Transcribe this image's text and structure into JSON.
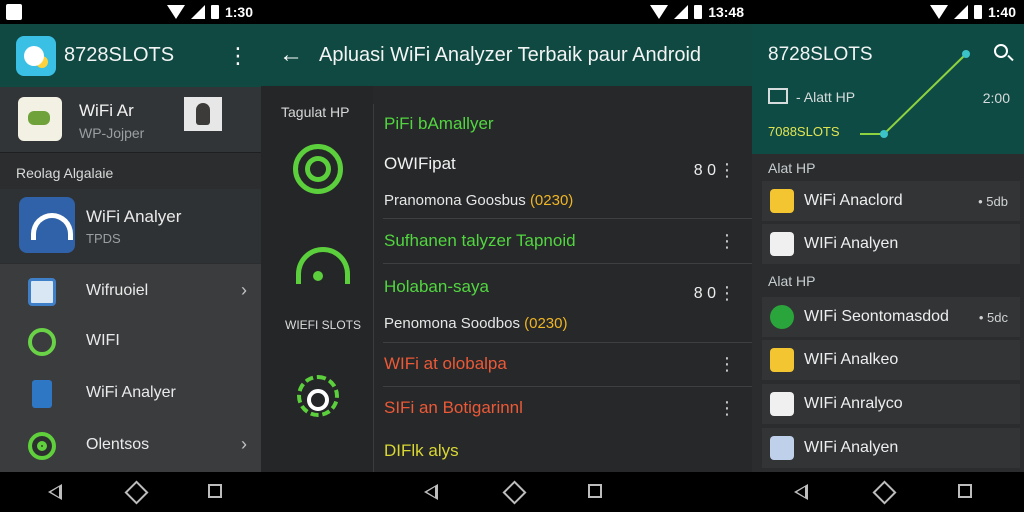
{
  "panel1": {
    "status_time": "1:30",
    "app_title": "8728SLOTS",
    "header": {
      "name": "WiFi Ar",
      "sub": "WP-Jojper"
    },
    "section": "Reolag Algalaie",
    "feature": {
      "name": "WiFi Analyer",
      "sub": "TPDS"
    },
    "menu": [
      {
        "label": "Wifruoiel",
        "icon": "device-icon",
        "chevron": true
      },
      {
        "label": "WIFI",
        "icon": "ring-icon",
        "chevron": false
      },
      {
        "label": "WiFi Analyer",
        "icon": "phone-icon",
        "chevron": false
      },
      {
        "label": "Olentsos",
        "icon": "target-icon",
        "chevron": true
      }
    ]
  },
  "panel2": {
    "status_time": "13:48",
    "title": "Apluasi WiFi Analyzer Terbaik paur Android",
    "left": {
      "header": "Tagulat HP",
      "caption": "WIEFI SLOTS"
    },
    "rows": [
      {
        "text": "PiFi bAmallyer",
        "color": "green"
      },
      {
        "text": "OWIFipat",
        "color": "white",
        "num": "8 0"
      },
      {
        "text": "Pranomona Goosbus",
        "highlight": "(0230)",
        "color": "sub"
      },
      {
        "text": "Sufhanen talyzer Tapnoid",
        "color": "green"
      },
      {
        "text": "Holaban-saya",
        "color": "green",
        "num": "8 0"
      },
      {
        "text": "Penomona Soodbos",
        "highlight": "(0230)",
        "color": "sub"
      },
      {
        "text": "WIFi at olobalpa",
        "color": "red"
      },
      {
        "text": "SIFi an Botigarinnl",
        "color": "red"
      },
      {
        "text": "DIFlk alys",
        "color": "yellow"
      }
    ]
  },
  "panel3": {
    "status_time": "1:40",
    "title": "8728SLOTS",
    "meta_label": "- Alatt HP",
    "meta_value": "2:00",
    "tag": "7088SLOTS",
    "section1": "Alat HP",
    "section2": "Alat HP",
    "items": [
      {
        "label": "WiFi Anaclord",
        "value": "• 5db",
        "icon": "yellow"
      },
      {
        "label": "WIFi Analyen",
        "value": "",
        "icon": "white"
      },
      {
        "label": "WIFi Seontomasdod",
        "value": "• 5dc",
        "icon": "green"
      },
      {
        "label": "WIFi Analkeo",
        "value": "",
        "icon": "yellow"
      },
      {
        "label": "WIFi Anralyco",
        "value": "",
        "icon": "white"
      },
      {
        "label": "WIFi Analyen",
        "value": "",
        "icon": "pink"
      }
    ]
  },
  "colors": {
    "appbar": "#104842",
    "accent_green": "#52d640",
    "accent_red": "#ec5937",
    "accent_yellow": "#d9d733"
  }
}
